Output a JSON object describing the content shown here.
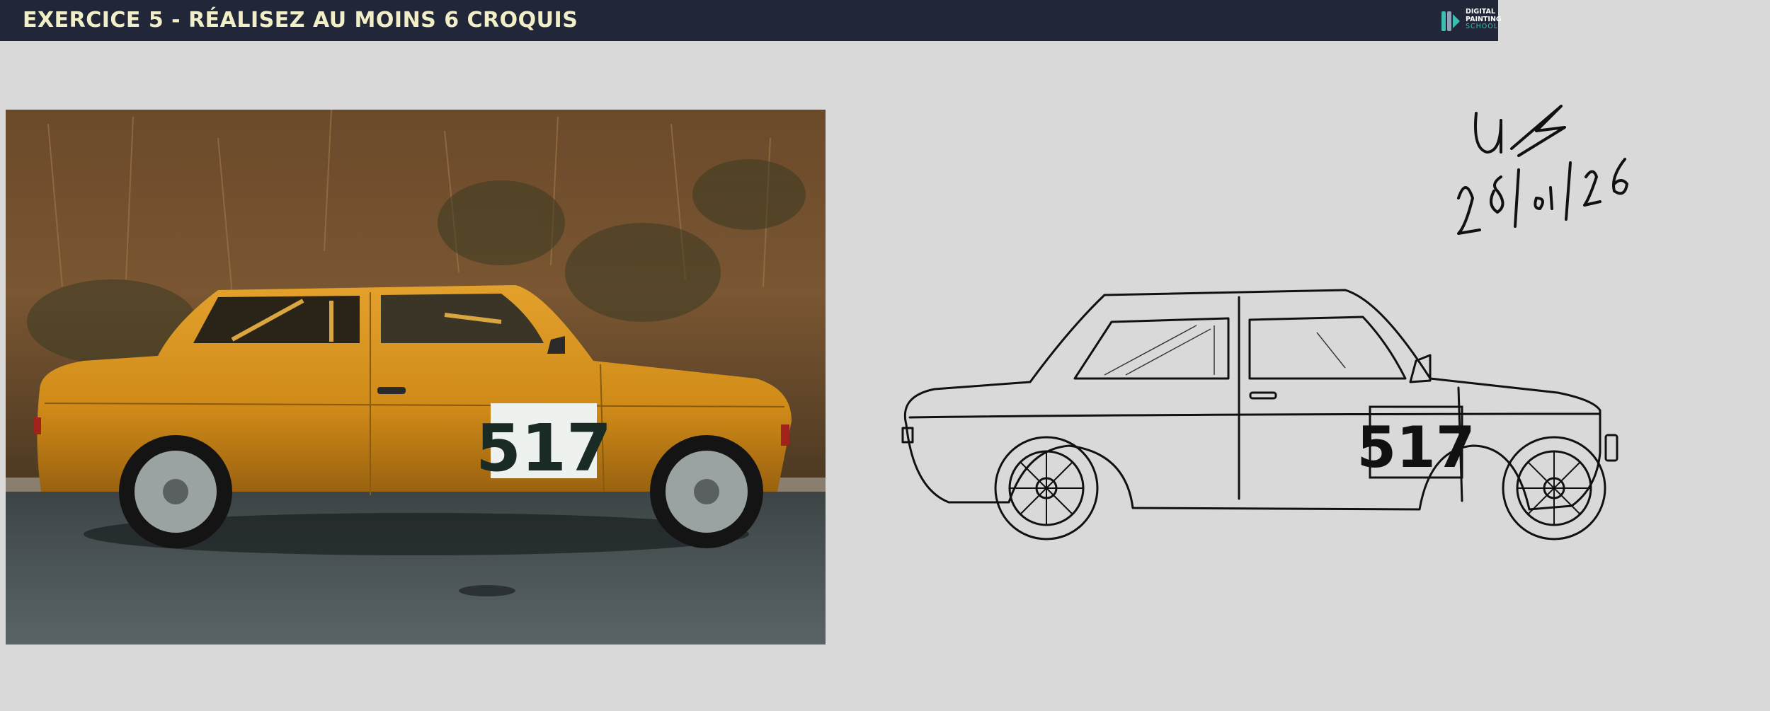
{
  "header": {
    "title": "EXERCICE 5 - RÉALISEZ AU MOINS 6 CROQUIS",
    "logo": {
      "icon": "paintbrush-logo-icon",
      "line1": "DIGITAL",
      "line2": "PAINTING",
      "line3": "SCHOOL"
    }
  },
  "reference_photo": {
    "subject": "orange-two-door-rally-car",
    "race_number": "517"
  },
  "sketch": {
    "race_number": "517"
  },
  "signature": {
    "initials": "UF",
    "date": "28/01/26"
  },
  "colors": {
    "background": "#d9d9d9",
    "header_bg": "#212638",
    "header_text": "#f2efc8",
    "car_orange": "#d6901a",
    "logo_accent": "#3bbfb0"
  }
}
